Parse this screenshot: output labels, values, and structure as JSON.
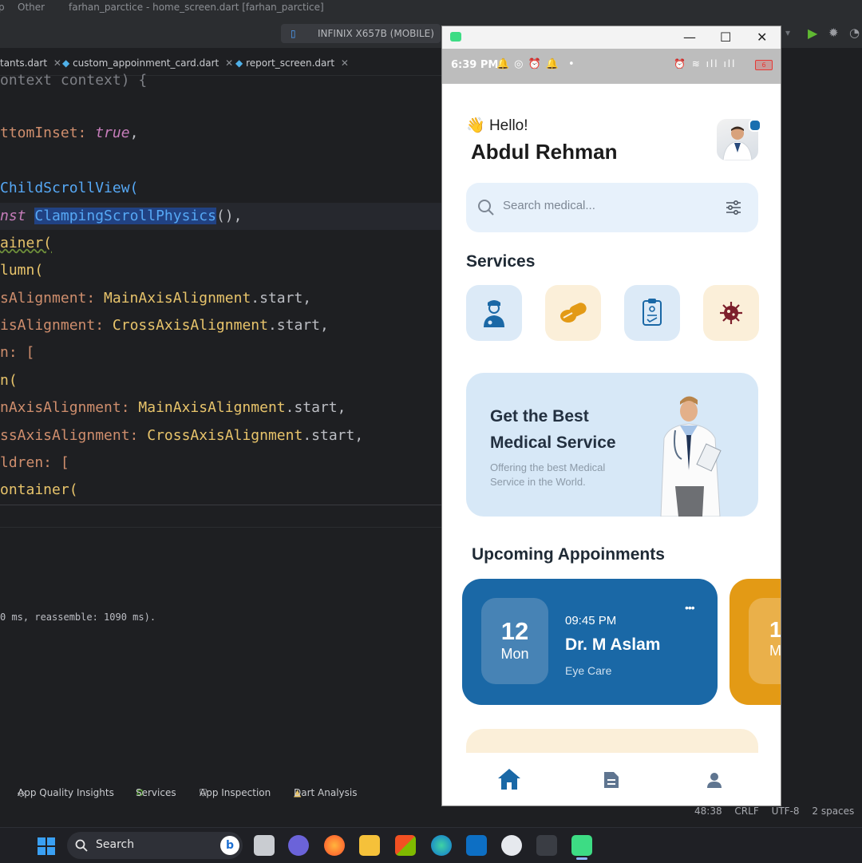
{
  "ide": {
    "menu_left": "p",
    "menu_other": "Other",
    "title": "farhan_parctice - home_screen.dart [farhan_parctice]",
    "device": "INFINIX X657B (MOBILE)",
    "tabs": [
      {
        "label": "tants.dart"
      },
      {
        "label": "custom_appoinment_card.dart"
      },
      {
        "label": "report_screen.dart"
      }
    ],
    "code_lines": [
      "ontext context) {",
      "ttomInset: ",
      "true",
      ",",
      "ChildScrollView(",
      "nst ",
      "ClampingScrollPhysics",
      "(),",
      "ainer(",
      "lumn(",
      "sAlignment: ",
      "MainAxisAlignment",
      ".start,",
      "isAlignment: ",
      "CrossAxisAlignment",
      ".start,",
      "n: [",
      "n(",
      "nAxisAlignment: ",
      "MainAxisAlignment",
      ".start,",
      "ssAxisAlignment: ",
      "CrossAxisAlignment",
      ".start,",
      "ldren: [",
      "ontainer("
    ],
    "log_line": "0 ms, reassemble: 1090 ms).",
    "bottom_tools": [
      {
        "label": "App Quality Insights"
      },
      {
        "label": "Services"
      },
      {
        "label": "App Inspection"
      },
      {
        "label": "Dart Analysis"
      }
    ],
    "status": {
      "position": "48:38",
      "line_sep": "CRLF",
      "encoding": "UTF-8",
      "indent": "2 spaces"
    }
  },
  "taskbar": {
    "search_label": "Search"
  },
  "phone": {
    "status_time": "6:39 PM",
    "status_dot": "•",
    "battery": "6",
    "greeting_emoji": "👋",
    "greeting": "Hello!",
    "user_name": "Abdul Rehman",
    "search_placeholder": "Search medical...",
    "services_title": "Services",
    "services": [
      {
        "icon": "doctor-icon",
        "bg": "#dceaf7"
      },
      {
        "icon": "pills-icon",
        "bg": "#fbefd9"
      },
      {
        "icon": "clipboard-icon",
        "bg": "#dceaf7"
      },
      {
        "icon": "virus-icon",
        "bg": "#fbefd9"
      }
    ],
    "banner": {
      "title_line1": "Get the Best",
      "title_line2": "Medical Service",
      "sub_line1": "Offering the best Medical",
      "sub_line2": "Service in the World."
    },
    "upcoming_title": "Upcoming Appoinments",
    "appointments": [
      {
        "day": "12",
        "weekday": "Mon",
        "time": "09:45 PM",
        "doctor": "Dr. M Aslam",
        "specialty": "Eye Care",
        "menu": "•••"
      },
      {
        "day": "1",
        "weekday": "M"
      }
    ],
    "colors": {
      "primary": "#1a68a6",
      "accent": "#e39a15",
      "light_blue": "#dceaf7",
      "light_cream": "#fbefd9"
    }
  }
}
